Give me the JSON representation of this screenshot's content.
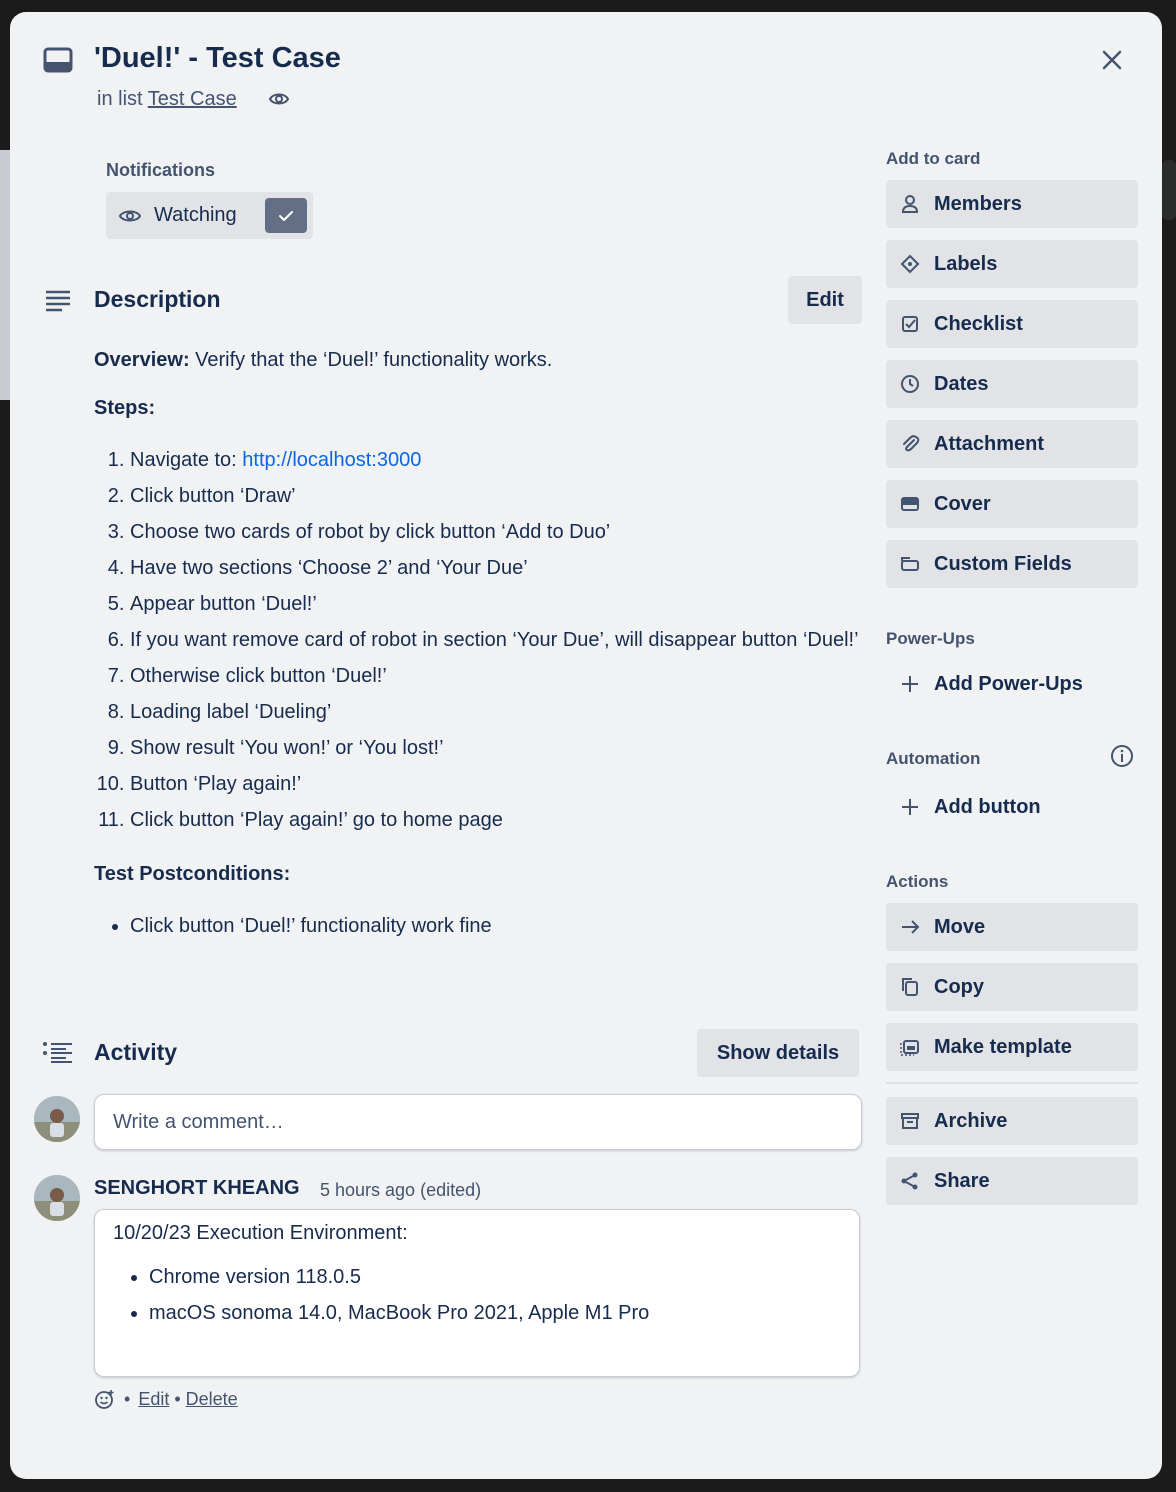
{
  "card": {
    "title": "'Duel!' - Test Case",
    "in_list_prefix": "in list",
    "list_name": "Test Case"
  },
  "notifications": {
    "label": "Notifications",
    "watch_label": "Watching"
  },
  "description": {
    "title": "Description",
    "edit_label": "Edit",
    "overview_label": "Overview:",
    "overview_text": " Verify that the ‘Duel!’ functionality works.",
    "steps_label": "Steps:",
    "step1_prefix": "Navigate to: ",
    "step1_link": "http://localhost:3000",
    "steps": [
      "Click button ‘Draw’",
      "Choose two cards of robot by click button ‘Add to Duo’",
      "Have two sections ‘Choose 2’ and ‘Your Due’",
      "Appear button ‘Duel!’",
      "If you want remove card of robot in section ‘Your Due’, will disappear button ‘Duel!’",
      "Otherwise click button ‘Duel!’",
      "Loading label ‘Dueling’",
      "Show result ‘You won!’ or ‘You lost!’",
      "Button ‘Play again!’",
      "Click button ‘Play again!’ go to home page"
    ],
    "postconditions_label": "Test Postconditions:",
    "postconditions": [
      "Click button ‘Duel!’ functionality work fine"
    ]
  },
  "activity": {
    "title": "Activity",
    "show_details_label": "Show details",
    "comment_placeholder": "Write a comment…",
    "comment": {
      "author": "SENGHORT KHEANG",
      "time": "5 hours ago (edited)",
      "line1": "10/20/23 Execution Environment:",
      "bullets": [
        "Chrome version 118.0.5",
        "macOS sonoma 14.0, MacBook Pro 2021, Apple M1 Pro"
      ],
      "edit_label": "Edit",
      "delete_label": "Delete",
      "separator": "•"
    }
  },
  "sidebar": {
    "add_to_card_label": "Add to card",
    "add_to_card": [
      "Members",
      "Labels",
      "Checklist",
      "Dates",
      "Attachment",
      "Cover",
      "Custom Fields"
    ],
    "powerups_label": "Power-Ups",
    "add_powerups": "Add Power-Ups",
    "automation_label": "Automation",
    "add_button": "Add button",
    "actions_label": "Actions",
    "actions": [
      "Move",
      "Copy",
      "Make template"
    ],
    "archive": "Archive",
    "share": "Share"
  },
  "icons": {
    "card": "card-icon",
    "close": "close-icon",
    "eye": "eye-icon",
    "check": "check-icon",
    "description": "description-icon",
    "activity": "activity-icon",
    "info": "info-icon"
  },
  "colors": {
    "link": "#0c66e4",
    "button_bg": "#e1e3e7",
    "modal_bg": "#f1f2f4",
    "check_bg": "#626f86"
  }
}
